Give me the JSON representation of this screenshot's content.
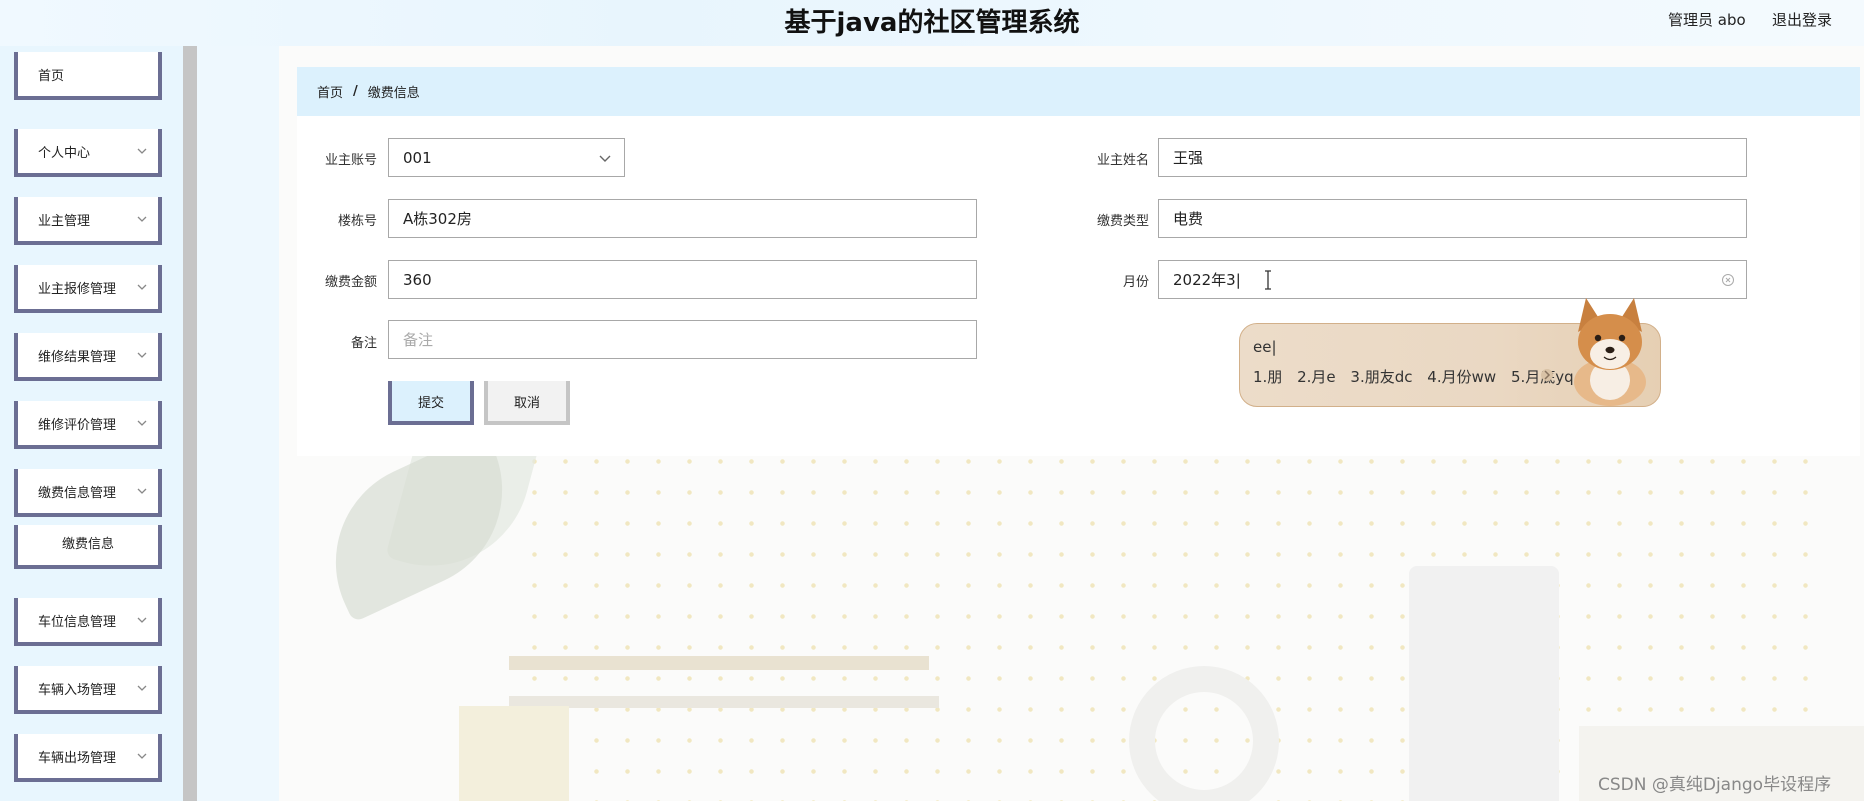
{
  "header": {
    "title": "基于java的社区管理系统",
    "user": "管理员 abo",
    "logout": "退出登录"
  },
  "sidebar": {
    "items": [
      {
        "label": "首页"
      },
      {
        "label": "个人中心"
      },
      {
        "label": "业主管理"
      },
      {
        "label": "业主报修管理"
      },
      {
        "label": "维修结果管理"
      },
      {
        "label": "维修评价管理"
      },
      {
        "label": "缴费信息管理"
      },
      {
        "label": "缴费信息"
      },
      {
        "label": "车位信息管理"
      },
      {
        "label": "车辆入场管理"
      },
      {
        "label": "车辆出场管理"
      }
    ]
  },
  "breadcrumb": {
    "home": "首页",
    "separator": "/",
    "current": "缴费信息"
  },
  "form": {
    "owner_account": {
      "label": "业主账号",
      "value": "001"
    },
    "owner_name": {
      "label": "业主姓名",
      "value": "王强"
    },
    "building": {
      "label": "楼栋号",
      "value": "A栋302房"
    },
    "payment_type": {
      "label": "缴费类型",
      "value": "电费"
    },
    "amount": {
      "label": "缴费金额",
      "value": "360"
    },
    "month": {
      "label": "月份",
      "value": "2022年3|"
    },
    "remark": {
      "label": "备注",
      "placeholder": "备注"
    },
    "submit": "提交",
    "cancel": "取消"
  },
  "ime": {
    "input": "ee|",
    "candidates": [
      "1.朋",
      "2.月e",
      "3.朋友dc",
      "4.月份ww",
      "5.月底yq"
    ]
  },
  "watermark": "CSDN @真纯Django毕设程序",
  "colors": {
    "accent_border": "#6b6e93",
    "breadcrumb_bg": "#dcf1fd",
    "sidebar_bg": "#e8f6fe"
  }
}
